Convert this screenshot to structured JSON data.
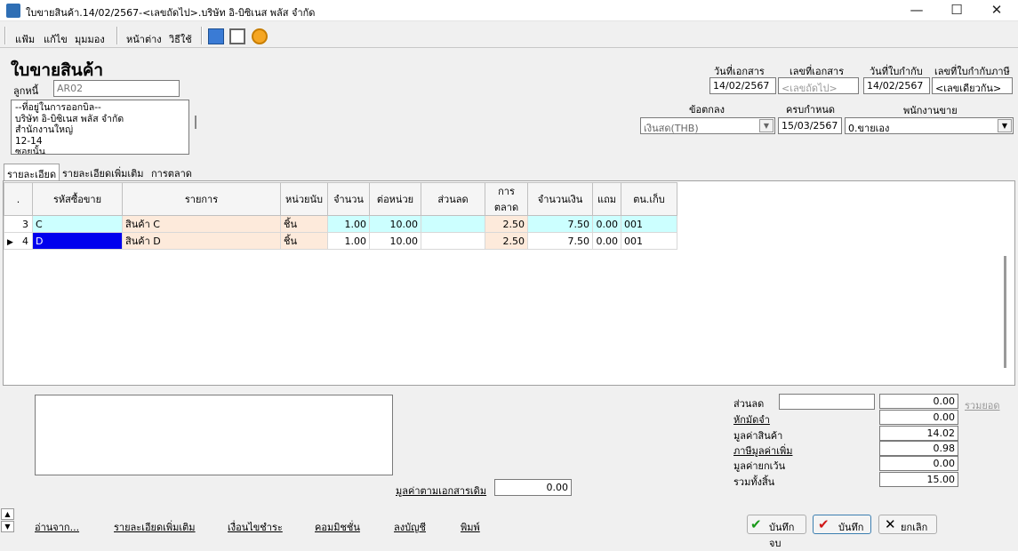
{
  "window": {
    "title": "ใบขายสินค้า.14/02/2567-<เลขถัดไป>.บริษัท อิ-บิซิเนส พลัส จำกัด",
    "minimize": "—",
    "maximize": "☐",
    "close": "✕"
  },
  "menu": {
    "file": "แฟ้ม",
    "edit": "แก้ไข",
    "view": "มุมมอง",
    "window": "หน้าต่าง",
    "help": "วิธีใช้"
  },
  "header": {
    "title": "ใบขายสินค้า",
    "customer_label": "ลูกหนี้",
    "customer_code": "AR02",
    "address_lines": [
      "--ที่อยู่ในการออกบิล--",
      "บริษัท อิ-บิซิเนส พลัส จำกัด",
      "สำนักงานใหญ่",
      "12-14",
      "ซอยนั้น"
    ],
    "doc_date_label": "วันที่เอกสาร",
    "doc_no_label": "เลขที่เอกสาร",
    "tax_date_label": "วันที่ใบกำกับ",
    "tax_no_label": "เลขที่ใบกำกับภาษี",
    "doc_date": "14/02/2567",
    "doc_no_placeholder": "<เลขถัดไป>",
    "tax_date": "14/02/2567",
    "tax_no": "<เลขเดียวกัน>",
    "terms_label": "ข้อตกลง",
    "due_label": "ครบกำหนด",
    "salesperson_label": "พนักงานขาย",
    "terms": "เงินสด(THB)",
    "due_date": "15/03/2567",
    "salesperson": "0.ขายเอง"
  },
  "tabs": [
    "รายละเอียด",
    "รายละเอียดเพิ่มเติม",
    "การตลาด"
  ],
  "grid": {
    "columns": [
      ".",
      "รหัสซื้อขาย",
      "รายการ",
      "หน่วยนับ",
      "จำนวน",
      "ต่อหน่วย",
      "ส่วนลด",
      "การตลาด",
      "จำนวนเงิน",
      "แถม",
      "ตน.เก็บ"
    ],
    "rows": [
      {
        "marker": "",
        "no": "3",
        "code": "C",
        "item": "สินค้า C",
        "unit": "ชิ้น",
        "qty": "1.00",
        "price": "10.00",
        "discount": "",
        "marketing": "2.50",
        "amount": "7.50",
        "free": "0.00",
        "store": "001"
      },
      {
        "marker": "▶",
        "no": "4",
        "code": "D",
        "item": "สินค้า D",
        "unit": "ชิ้น",
        "qty": "1.00",
        "price": "10.00",
        "discount": "",
        "marketing": "2.50",
        "amount": "7.50",
        "free": "0.00",
        "store": "001"
      }
    ]
  },
  "summary": {
    "discount_label": "ส่วนลด",
    "discount_input": "",
    "discount": "0.00",
    "sum_link": "รวมยอด",
    "deposit_label": "หักมัดจำ",
    "deposit": "0.00",
    "goods_label": "มูลค่าสินค้า",
    "goods": "14.02",
    "vat_label": "ภาษีมูลค่าเพิ่ม",
    "vat": "0.98",
    "exempt_label": "มูลค่ายกเว้น",
    "exempt": "0.00",
    "total_label": "รวมทั้งสิ้น",
    "total": "15.00",
    "orig_doc_label": "มูลค่าตามเอกสารเดิม",
    "orig_doc": "0.00"
  },
  "footer": {
    "links": [
      "อ่านจาก...",
      "รายละเอียดเพิ่มเติม",
      "เงื่อนไขชำระ",
      "คอมมิชชั่น",
      "ลงบัญชี",
      "พิมพ์"
    ],
    "save_close": "บันทึกจบ",
    "save": "บันทึก",
    "cancel": "ยกเลิก"
  },
  "colors": {
    "row_selected": "#ccffff",
    "peach": "#fdeadb",
    "focus_cell": "#0000ee"
  }
}
